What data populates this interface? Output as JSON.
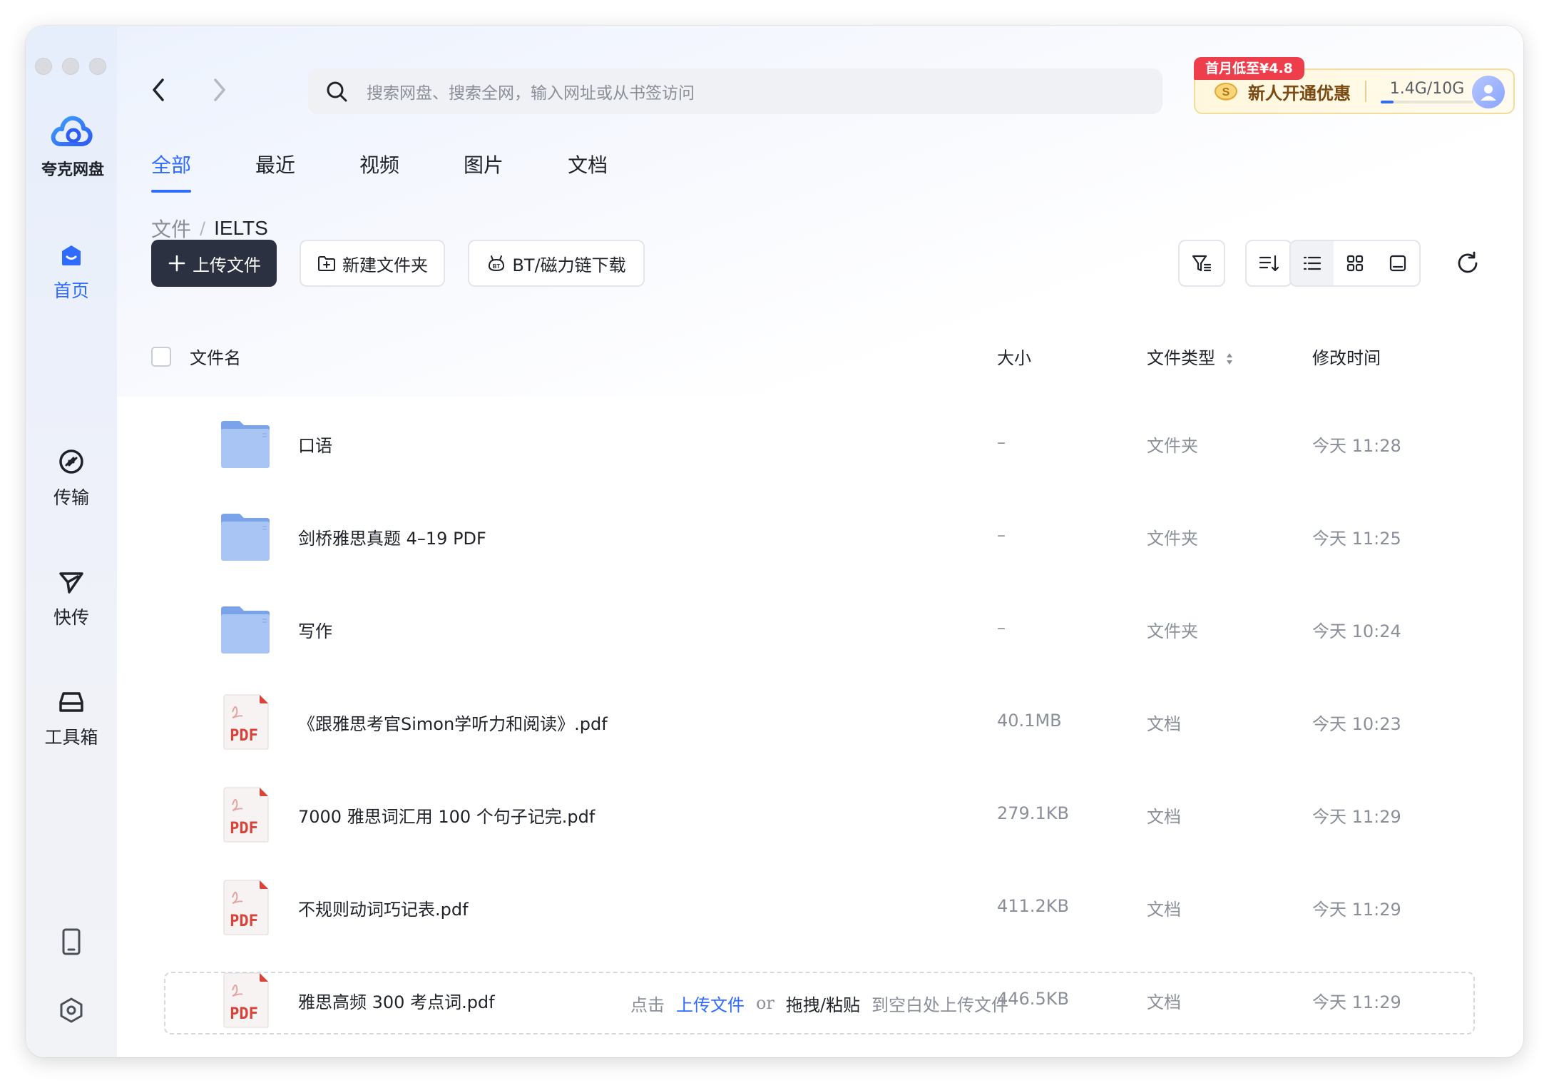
{
  "app": {
    "name": "夸克网盘"
  },
  "sidebar": {
    "items": [
      {
        "label": "首页",
        "icon": "home-icon",
        "active": true
      },
      {
        "label": "传输",
        "icon": "transfer-icon",
        "active": false
      },
      {
        "label": "快传",
        "icon": "paper-plane-icon",
        "active": false
      },
      {
        "label": "工具箱",
        "icon": "toolbox-icon",
        "active": false
      }
    ],
    "bottom_icons": [
      "phone-icon",
      "settings-hexagon-icon"
    ]
  },
  "search": {
    "placeholder": "搜索网盘、搜索全网，输入网址或从书签访问"
  },
  "promo": {
    "tag": "首月低至¥4.8",
    "text": "新人开通优惠",
    "quota": "1.4G/10G",
    "quota_fraction": 0.14
  },
  "tabs": [
    {
      "label": "全部",
      "active": true
    },
    {
      "label": "最近",
      "active": false
    },
    {
      "label": "视频",
      "active": false
    },
    {
      "label": "图片",
      "active": false
    },
    {
      "label": "文档",
      "active": false
    }
  ],
  "breadcrumb": {
    "root": "文件",
    "separator": "/",
    "current": "IELTS"
  },
  "toolbar": {
    "upload": "上传文件",
    "new_folder": "新建文件夹",
    "bt_download": "BT/磁力链下载"
  },
  "table": {
    "headers": {
      "name": "文件名",
      "size": "大小",
      "type": "文件类型",
      "modified": "修改时间"
    },
    "rows": [
      {
        "kind": "folder",
        "name": "口语",
        "size": "–",
        "type": "文件夹",
        "modified": "今天 11:28"
      },
      {
        "kind": "folder",
        "name": "剑桥雅思真题 4–19 PDF",
        "size": "–",
        "type": "文件夹",
        "modified": "今天 11:25"
      },
      {
        "kind": "folder",
        "name": "写作",
        "size": "–",
        "type": "文件夹",
        "modified": "今天 10:24"
      },
      {
        "kind": "pdf",
        "name": "《跟雅思考官Simon学听力和阅读》.pdf",
        "size": "40.1MB",
        "type": "文档",
        "modified": "今天 10:23"
      },
      {
        "kind": "pdf",
        "name": "7000 雅思词汇用 100 个句子记完.pdf",
        "size": "279.1KB",
        "type": "文档",
        "modified": "今天 11:29"
      },
      {
        "kind": "pdf",
        "name": "不规则动词巧记表.pdf",
        "size": "411.2KB",
        "type": "文档",
        "modified": "今天 11:29"
      },
      {
        "kind": "pdf",
        "name": "雅思高频 300 考点词.pdf",
        "size": "446.5KB",
        "type": "文档",
        "modified": "今天 11:29"
      }
    ]
  },
  "pdf_icon_label": "PDF",
  "dropzone": {
    "click": "点击",
    "upload_link": "上传文件",
    "or": "or",
    "drag_paste": "拖拽/粘贴",
    "suffix": "到空白处上传文件"
  },
  "colors": {
    "accent": "#2f6bff",
    "primary_button": "#2b3140",
    "promo_tag": "#ee3d4b",
    "pdf_red": "#d9433a",
    "folder_blue": "#8fb4f0"
  }
}
